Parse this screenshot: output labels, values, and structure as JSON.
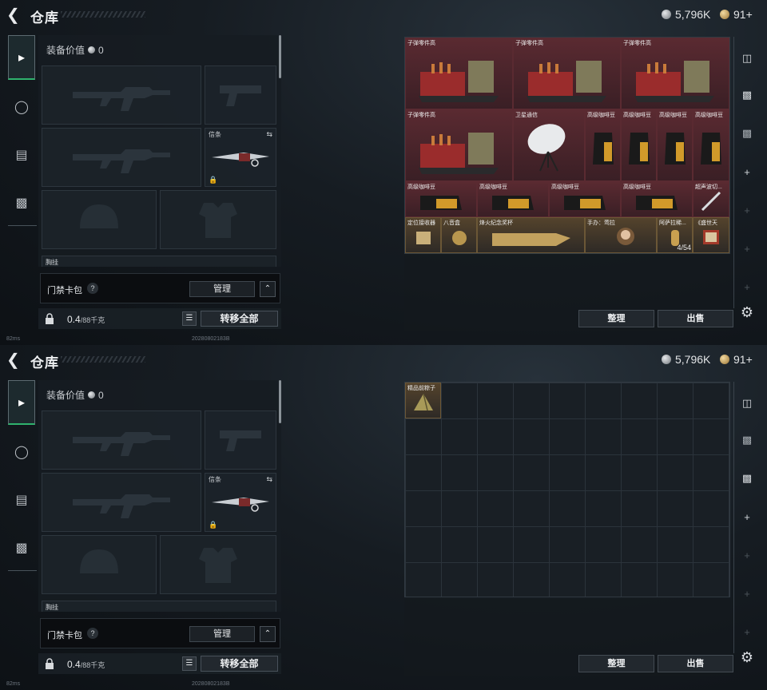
{
  "header": {
    "title": "仓库",
    "silver_amount": "5,796K",
    "gold_amount": "91+"
  },
  "equipment": {
    "value_label": "装备价值",
    "value": "0",
    "knife_label": "信条",
    "pouch_label": "胸挂"
  },
  "keycard": {
    "label": "门禁卡包",
    "help": "?",
    "manage_label": "管理"
  },
  "capacity": {
    "weight": "0.4",
    "max": "/88千克",
    "transfer_all_label": "转移全部"
  },
  "status": {
    "ping": "82ms",
    "build_stamp": "20280802183B"
  },
  "actions": {
    "sort_label": "整理",
    "sell_label": "出售"
  },
  "storage_top": {
    "items": [
      {
        "label": "子弹零件高"
      },
      {
        "label": "子弹零件高"
      },
      {
        "label": "子弹零件高"
      },
      {
        "label": "子弹零件高"
      },
      {
        "label": "卫星通信"
      },
      {
        "label": "高级咖啡豆"
      },
      {
        "label": "高级咖啡豆"
      },
      {
        "label": "高级咖啡豆"
      },
      {
        "label": "高级咖啡豆"
      },
      {
        "label": "高级咖啡豆"
      },
      {
        "label": "高级咖啡豆"
      },
      {
        "label": "高级咖啡豆"
      },
      {
        "label": "高级咖啡豆"
      },
      {
        "label": "超声波切..."
      },
      {
        "label": "定位接收器"
      },
      {
        "label": "八音盒"
      },
      {
        "label": "烽火纪念奖杯"
      },
      {
        "label": "手办：莺拉"
      },
      {
        "label": "阿萨拉稀..."
      },
      {
        "label": "《盛世天"
      }
    ],
    "count": "4/54"
  },
  "storage_bottom": {
    "items": [
      {
        "label": "精品前粽子"
      }
    ]
  },
  "colors": {
    "accent_green": "#2fb26d",
    "item_red": "#5a2a31",
    "item_gold": "#54432c"
  }
}
